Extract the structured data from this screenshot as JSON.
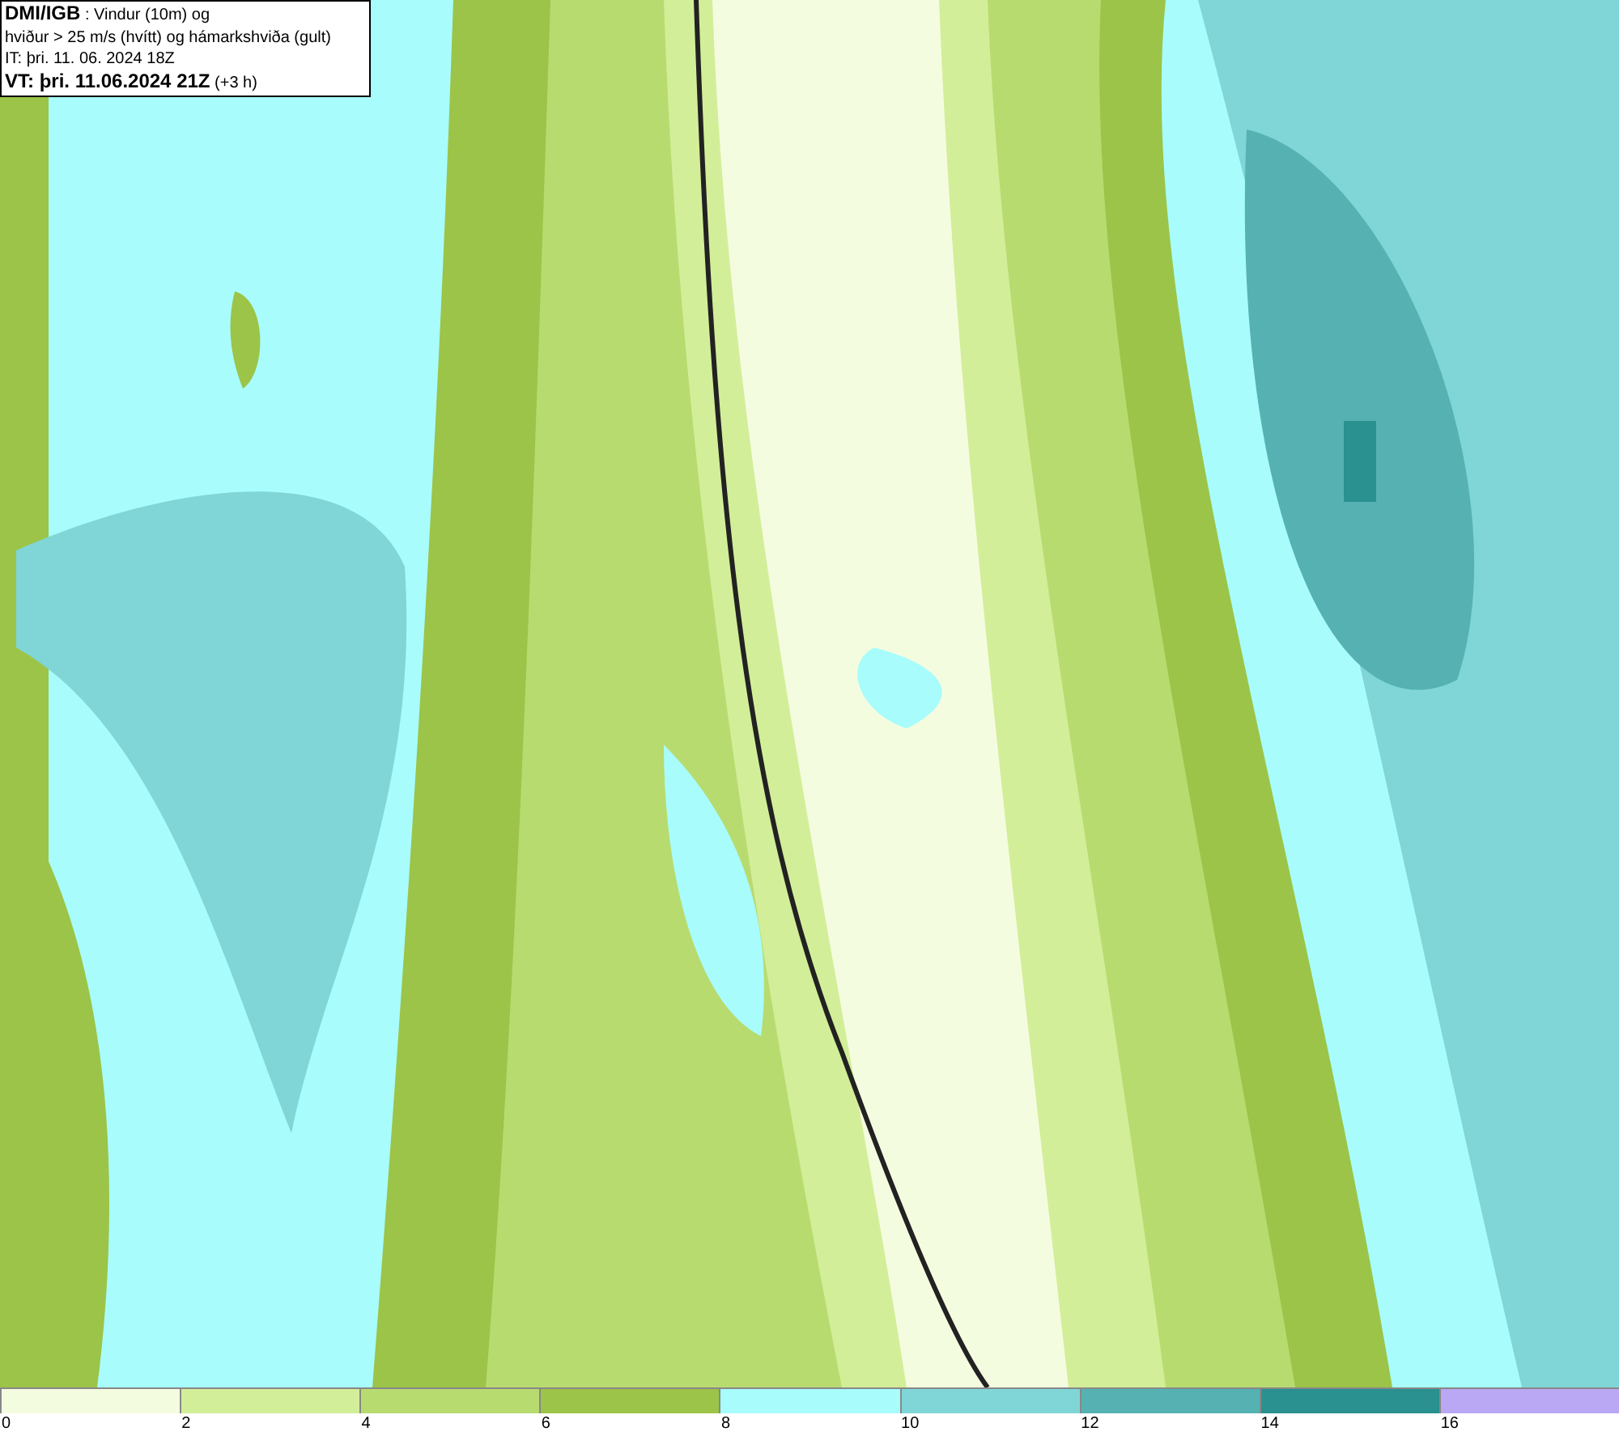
{
  "info_box": {
    "lines": [
      "**DMI/IGB** : Vindur (10m) og",
      "hviður > 25 m/s (hvítt) og hámarkshviða (gult)",
      "IT: þri. 11. 06. 2024 18Z",
      "**VT: þri. 11.06.2024 21Z** (+3 h)"
    ]
  },
  "legend": [
    {
      "label": "0",
      "color": "#f4fce0"
    },
    {
      "label": "2",
      "color": "#d3ee98"
    },
    {
      "label": "4",
      "color": "#b8db70"
    },
    {
      "label": "6",
      "color": "#9cc448"
    },
    {
      "label": "8",
      "color": "#a8fcfc"
    },
    {
      "label": "10",
      "color": "#80d6d6"
    },
    {
      "label": "12",
      "color": "#56b2b2"
    },
    {
      "label": "14",
      "color": "#2a9090"
    },
    {
      "label": "16",
      "color": "#baa8f4"
    }
  ]
}
